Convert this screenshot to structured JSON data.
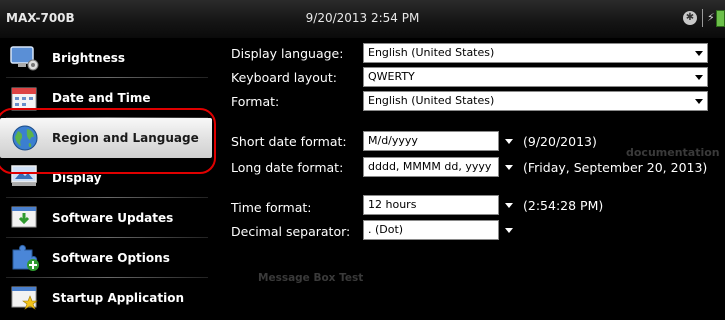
{
  "titlebar": {
    "device": "MAX-700B",
    "datetime": "9/20/2013 2:54 PM"
  },
  "sidebar": {
    "items": [
      {
        "label": "Brightness",
        "icon": "brightness-icon"
      },
      {
        "label": "Date and Time",
        "icon": "calendar-icon"
      },
      {
        "label": "Region and Language",
        "icon": "globe-icon",
        "selected": true
      },
      {
        "label": "Display",
        "icon": "display-icon"
      },
      {
        "label": "Software Updates",
        "icon": "software-update-icon"
      },
      {
        "label": "Software Options",
        "icon": "puzzle-icon"
      },
      {
        "label": "Startup Application",
        "icon": "startup-star-icon"
      }
    ]
  },
  "settings": {
    "display_language": {
      "label": "Display language:",
      "value": "English (United States)"
    },
    "keyboard_layout": {
      "label": "Keyboard layout:",
      "value": "QWERTY"
    },
    "format": {
      "label": "Format:",
      "value": "English (United States)"
    },
    "short_date": {
      "label": "Short date format:",
      "value": "M/d/yyyy",
      "example": "(9/20/2013)"
    },
    "long_date": {
      "label": "Long date format:",
      "value": "dddd, MMMM dd, yyyy",
      "example": "(Friday, September 20, 2013)"
    },
    "time_format": {
      "label": "Time format:",
      "value": "12 hours",
      "example": "(2:54:28 PM)"
    },
    "decimal_separator": {
      "label": "Decimal separator:",
      "value": ". (Dot)"
    }
  },
  "background_ghost_text": {
    "documentation": "documentation",
    "message_box": "Message Box Test"
  },
  "colors": {
    "highlight_ring": "#e00000",
    "battery": "#6cc04a"
  }
}
